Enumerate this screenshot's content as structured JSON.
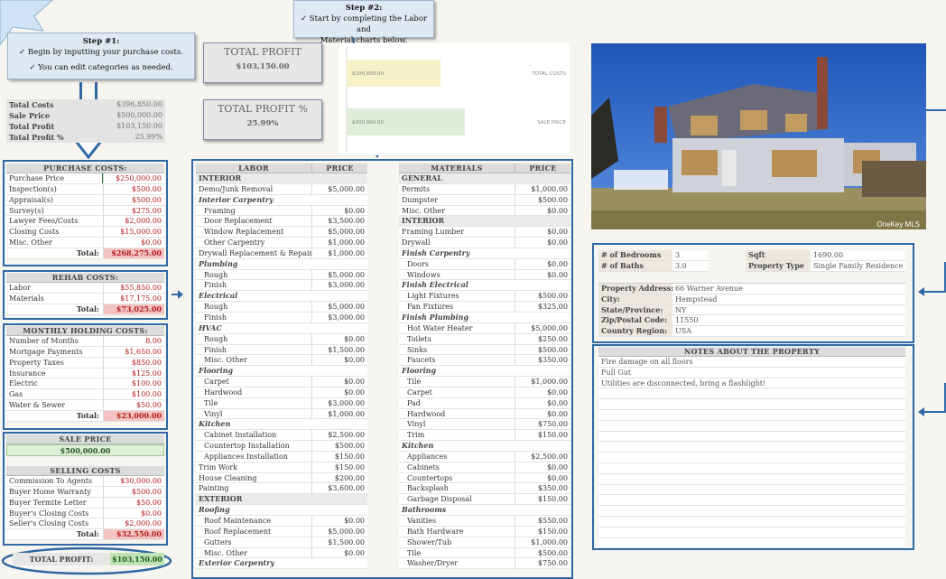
{
  "step1": {
    "title": "Step #1:",
    "line1": "✓  Begin by inputting your purchase costs.",
    "line2": "✓ You can edit categories as needed."
  },
  "step2": {
    "title": "Step #2:",
    "line1": "✓  Start by completing the Labor and",
    "line2": "Material charts below."
  },
  "summary": [
    {
      "label": "Total Costs",
      "value": "$396,850.00"
    },
    {
      "label": "Sale Price",
      "value": "$500,000.00"
    },
    {
      "label": "Total Profit",
      "value": "$103,150.00"
    },
    {
      "label": "Total Profit %",
      "value": "25.99%"
    }
  ],
  "kpis": {
    "profit_label": "TOTAL PROFIT",
    "profit_value": "$103,150.00",
    "pct_label": "TOTAL PROFIT %",
    "pct_value": "25.99%"
  },
  "chart_data": {
    "type": "bar",
    "categories": [
      "TOTAL COSTS",
      "SALE PRICE"
    ],
    "values": [
      396850,
      500000
    ],
    "data_labels": [
      "$396,850.00",
      "$500,000.00"
    ],
    "colors": [
      "#f6f1c8",
      "#e0eed9"
    ],
    "xlim": [
      0,
      1000000
    ]
  },
  "purchase": {
    "title": "PURCHASE COSTS:",
    "rows": [
      {
        "label": "Purchase Price",
        "value": "$250,000.00"
      },
      {
        "label": "Inspection(s)",
        "value": "$500.00"
      },
      {
        "label": "Appraisal(s)",
        "value": "$500.00"
      },
      {
        "label": "Survey(s)",
        "value": "$275.00"
      },
      {
        "label": "Lawyer Fees/Costs",
        "value": "$2,000.00"
      },
      {
        "label": "Closing Costs",
        "value": "$15,000.00"
      },
      {
        "label": "Misc. Other",
        "value": "$0.00"
      }
    ],
    "total_label": "Total:",
    "total": "$268,275.00"
  },
  "rehab": {
    "title": "REHAB COSTS:",
    "rows": [
      {
        "label": "Labor",
        "value": "$55,850.00"
      },
      {
        "label": "Materials",
        "value": "$17,175.00"
      }
    ],
    "total_label": "Total:",
    "total": "$73,025.00"
  },
  "holding": {
    "title": "MONTHLY HOLDING COSTS:",
    "rows": [
      {
        "label": "Number of Months",
        "value": "8.00"
      },
      {
        "label": "Mortgage Payments",
        "value": "$1,650.00"
      },
      {
        "label": "Property Taxes",
        "value": "$850.00"
      },
      {
        "label": "Insurance",
        "value": "$125.00"
      },
      {
        "label": "Electric",
        "value": "$100.00"
      },
      {
        "label": "Gas",
        "value": "$100.00"
      },
      {
        "label": "Water & Sewer",
        "value": "$50.00"
      }
    ],
    "total_label": "Total:",
    "total": "$23,000.00"
  },
  "sale": {
    "title": "SALE PRICE",
    "value": "$500,000.00"
  },
  "selling": {
    "title": "SELLING COSTS",
    "rows": [
      {
        "label": "Commission To Agents",
        "value": "$30,000.00"
      },
      {
        "label": "Buyer Home Warranty",
        "value": "$500.00"
      },
      {
        "label": "Buyer Termite Letter",
        "value": "$50.00"
      },
      {
        "label": "Buyer's Closing Costs",
        "value": "$0.00"
      },
      {
        "label": "Seller's Closing Costs",
        "value": "$2,000.00"
      }
    ],
    "total_label": "Total:",
    "total": "$32,550.00"
  },
  "total_profit": {
    "label": "TOTAL PROFIT:",
    "value": "$103,150.00"
  },
  "labor": {
    "col1": "LABOR",
    "col2": "PRICE",
    "rows": [
      {
        "t": "sec",
        "label": "INTERIOR",
        "value": ""
      },
      {
        "t": "item",
        "label": "Demo/Junk Removal",
        "value": "$5,000.00"
      },
      {
        "t": "cat",
        "label": "Interior Carpentry",
        "value": ""
      },
      {
        "t": "sub",
        "label": "Framing",
        "value": "$0.00"
      },
      {
        "t": "sub",
        "label": "Door Replacement",
        "value": "$3,500.00"
      },
      {
        "t": "sub",
        "label": "Window Replacement",
        "value": "$5,000.00"
      },
      {
        "t": "sub",
        "label": "Other Carpentry",
        "value": "$1,000.00"
      },
      {
        "t": "item",
        "label": "Drywall Replacement & Repair",
        "value": "$1,000.00"
      },
      {
        "t": "cat",
        "label": "Plumbing",
        "value": ""
      },
      {
        "t": "sub",
        "label": "Rough",
        "value": "$5,000.00"
      },
      {
        "t": "sub",
        "label": "Finish",
        "value": "$3,000.00"
      },
      {
        "t": "cat",
        "label": "Electrical",
        "value": ""
      },
      {
        "t": "sub",
        "label": "Rough",
        "value": "$5,000.00"
      },
      {
        "t": "sub",
        "label": "Finish",
        "value": "$3,000.00"
      },
      {
        "t": "cat",
        "label": "HVAC",
        "value": ""
      },
      {
        "t": "sub",
        "label": "Rough",
        "value": "$0.00"
      },
      {
        "t": "sub",
        "label": "Finish",
        "value": "$1,500.00"
      },
      {
        "t": "sub",
        "label": "Misc. Other",
        "value": "$0.00"
      },
      {
        "t": "cat",
        "label": "Flooring",
        "value": ""
      },
      {
        "t": "sub",
        "label": "Carpet",
        "value": "$0.00"
      },
      {
        "t": "sub",
        "label": "Hardwood",
        "value": "$0.00"
      },
      {
        "t": "sub",
        "label": "Tile",
        "value": "$3,000.00"
      },
      {
        "t": "sub",
        "label": "Vinyl",
        "value": "$1,000.00"
      },
      {
        "t": "cat",
        "label": "Kitchen",
        "value": ""
      },
      {
        "t": "sub",
        "label": "Cabinet Installation",
        "value": "$2,500.00"
      },
      {
        "t": "sub",
        "label": "Countertop Installation",
        "value": "$500.00"
      },
      {
        "t": "sub",
        "label": "Appliances Installation",
        "value": "$150.00"
      },
      {
        "t": "item",
        "label": "Trim Work",
        "value": "$150.00"
      },
      {
        "t": "item",
        "label": "House Cleaning",
        "value": "$200.00"
      },
      {
        "t": "item",
        "label": "Painting",
        "value": "$3,600.00"
      },
      {
        "t": "sec",
        "label": "EXTERIOR",
        "value": ""
      },
      {
        "t": "cat",
        "label": "Roofing",
        "value": ""
      },
      {
        "t": "sub",
        "label": "Roof Maintenance",
        "value": "$0.00"
      },
      {
        "t": "sub",
        "label": "Roof Replacement",
        "value": "$5,000.00"
      },
      {
        "t": "sub",
        "label": "Gutters",
        "value": "$1,500.00"
      },
      {
        "t": "sub",
        "label": "Misc. Other",
        "value": "$0.00"
      },
      {
        "t": "cat",
        "label": "Exterior Carpentry",
        "value": ""
      }
    ]
  },
  "materials": {
    "col1": "MATERIALS",
    "col2": "PRICE",
    "rows": [
      {
        "t": "sec",
        "label": "GENERAL",
        "value": ""
      },
      {
        "t": "item",
        "label": "Permits",
        "value": "$1,000.00"
      },
      {
        "t": "item",
        "label": "Dumpster",
        "value": "$500.00"
      },
      {
        "t": "item",
        "label": "Misc. Other",
        "value": "$0.00"
      },
      {
        "t": "sec",
        "label": "INTERIOR",
        "value": ""
      },
      {
        "t": "item",
        "label": "Framing Lumber",
        "value": "$0.00"
      },
      {
        "t": "item",
        "label": "Drywall",
        "value": "$0.00"
      },
      {
        "t": "cat",
        "label": "Finish Carpentry",
        "value": ""
      },
      {
        "t": "sub",
        "label": "Doors",
        "value": "$0.00"
      },
      {
        "t": "sub",
        "label": "Windows",
        "value": "$0.00"
      },
      {
        "t": "cat",
        "label": "Finish Electrical",
        "value": ""
      },
      {
        "t": "sub",
        "label": "Light Fixtures",
        "value": "$500.00"
      },
      {
        "t": "sub",
        "label": "Fan Fixtures",
        "value": "$325.00"
      },
      {
        "t": "cat",
        "label": "Finish Plumbing",
        "value": ""
      },
      {
        "t": "sub",
        "label": "Hot Water Heater",
        "value": "$5,000.00"
      },
      {
        "t": "sub",
        "label": "Toilets",
        "value": "$250.00"
      },
      {
        "t": "sub",
        "label": "Sinks",
        "value": "$500.00"
      },
      {
        "t": "sub",
        "label": "Faucets",
        "value": "$350.00"
      },
      {
        "t": "cat",
        "label": "Flooring",
        "value": ""
      },
      {
        "t": "sub",
        "label": "Tile",
        "value": "$1,000.00"
      },
      {
        "t": "sub",
        "label": "Carpet",
        "value": "$0.00"
      },
      {
        "t": "sub",
        "label": "Pad",
        "value": "$0.00"
      },
      {
        "t": "sub",
        "label": "Hardwood",
        "value": "$0.00"
      },
      {
        "t": "sub",
        "label": "Vinyl",
        "value": "$750.00"
      },
      {
        "t": "sub",
        "label": "Trim",
        "value": "$150.00"
      },
      {
        "t": "cat",
        "label": "Kitchen",
        "value": ""
      },
      {
        "t": "sub",
        "label": "Appliances",
        "value": "$2,500.00"
      },
      {
        "t": "sub",
        "label": "Cabinets",
        "value": "$0.00"
      },
      {
        "t": "sub",
        "label": "Countertops",
        "value": "$0.00"
      },
      {
        "t": "sub",
        "label": "Backsplash",
        "value": "$350.00"
      },
      {
        "t": "sub",
        "label": "Garbage Disposal",
        "value": "$150.00"
      },
      {
        "t": "cat",
        "label": "Bathrooms",
        "value": ""
      },
      {
        "t": "sub",
        "label": "Vanities",
        "value": "$550.00"
      },
      {
        "t": "sub",
        "label": "Bath Hardware",
        "value": "$150.00"
      },
      {
        "t": "sub",
        "label": "Shower/Tub",
        "value": "$1,000.00"
      },
      {
        "t": "sub",
        "label": "Tile",
        "value": "$500.00"
      },
      {
        "t": "sub",
        "label": "Washer/Dryer",
        "value": "$750.00"
      }
    ]
  },
  "photo": {
    "watermark": "OneKey MLS"
  },
  "property": {
    "bedrooms_label": "# of Bedrooms",
    "bedrooms": "3",
    "baths_label": "# of Baths",
    "baths": "3.0",
    "sqft_label": "Sqft",
    "sqft": "1690.00",
    "type_label": "Property Type",
    "type": "Single Family Residence",
    "address": [
      {
        "label": "Property Address:",
        "value": "66 Warner Avenue"
      },
      {
        "label": "City:",
        "value": "Hempstead"
      },
      {
        "label": "State/Province:",
        "value": "NY"
      },
      {
        "label": "Zip/Postal Code:",
        "value": "11550"
      },
      {
        "label": "Country Region:",
        "value": "USA"
      }
    ]
  },
  "notes": {
    "title": "NOTES ABOUT THE PROPERTY",
    "lines": [
      "Fire damage on all floors",
      "Full Gut",
      "Utilities are disconnected, bring a flashlight!",
      "",
      "",
      "",
      "",
      "",
      "",
      "",
      "",
      "",
      "",
      "",
      "",
      "",
      "",
      ""
    ]
  }
}
